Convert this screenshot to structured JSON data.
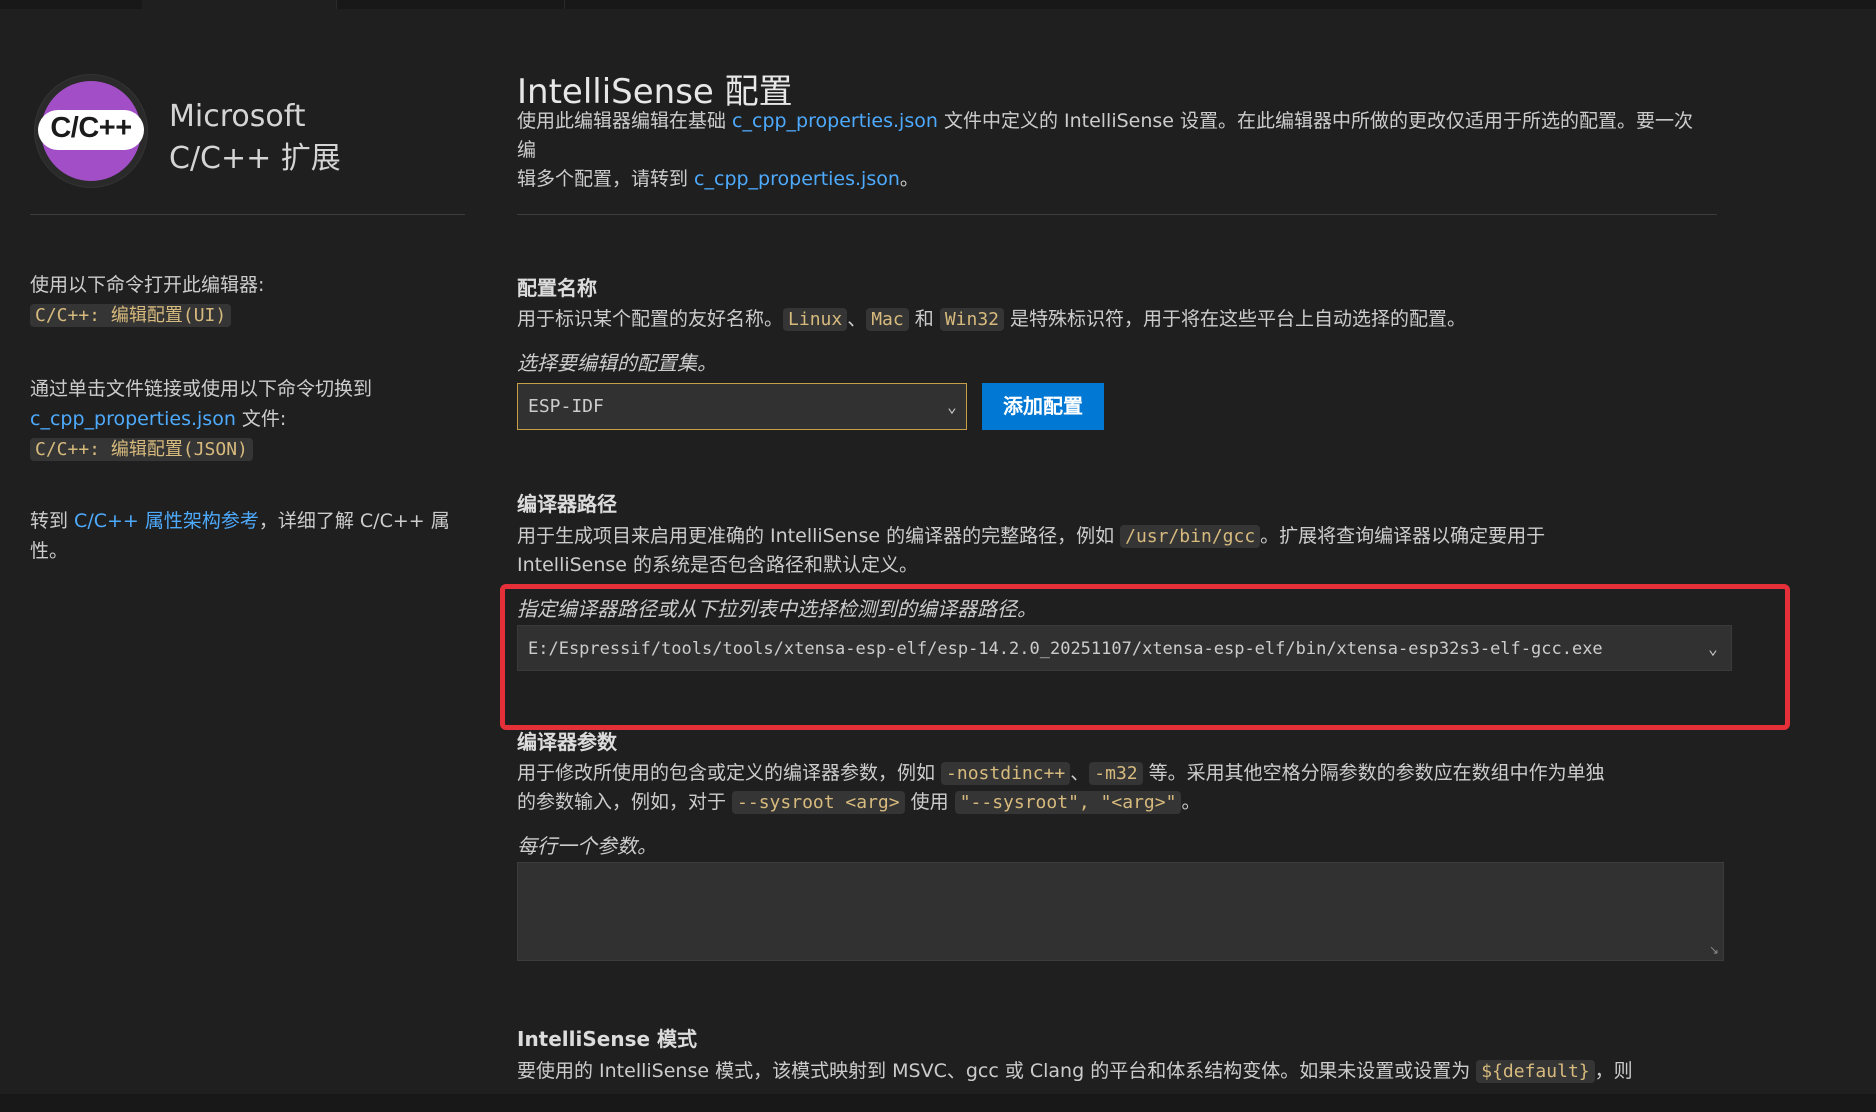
{
  "left": {
    "logo_text": "C/C++",
    "brand_line1": "Microsoft",
    "brand_line2": "C/C++ 扩展",
    "open_cmd_label": "使用以下命令打开此编辑器:",
    "open_cmd_code": "C/C++: 编辑配置(UI)",
    "switch_label_line1": "通过单击文件链接或使用以下命令切换到",
    "switch_link": "c_cpp_properties.json",
    "switch_label_tail": " 文件:",
    "switch_cmd_code": "C/C++: 编辑配置(JSON)",
    "schema_prefix": "转到 ",
    "schema_link": "C/C++ 属性架构参考",
    "schema_suffix_line1": "，详细了解 C/C++ 属",
    "schema_suffix_line2": "性。"
  },
  "header": {
    "title": "IntelliSense 配置",
    "desc_part1": "使用此编辑器编辑在基础 ",
    "desc_link1": "c_cpp_properties.json",
    "desc_part2": " 文件中定义的 IntelliSense 设置。在此编辑器中所做的更改仅适用于所选的配置。要一次编",
    "desc_part3": "辑多个配置，请转到 ",
    "desc_link2": "c_cpp_properties.json",
    "desc_part4": "。"
  },
  "config_name": {
    "title": "配置名称",
    "desc_a": "用于标识某个配置的友好名称。",
    "code1": "Linux",
    "sep1": "、",
    "code2": "Mac",
    "sep2": " 和 ",
    "code3": "Win32",
    "desc_b": " 是特殊标识符，用于将在这些平台上自动选择的配置。",
    "hint": "选择要编辑的配置集。",
    "selected": "ESP-IDF",
    "add_button": "添加配置"
  },
  "compiler_path": {
    "title": "编译器路径",
    "desc_a": "用于生成项目来启用更准确的 IntelliSense 的编译器的完整路径，例如 ",
    "code1": "/usr/bin/gcc",
    "desc_b": "。扩展将查询编译器以确定要用于",
    "desc_c": "IntelliSense 的系统是否包含路径和默认定义。",
    "hint": "指定编译器路径或从下拉列表中选择检测到的编译器路径。",
    "value": "E:/Espressif/tools/tools/xtensa-esp-elf/esp-14.2.0_20251107/xtensa-esp-elf/bin/xtensa-esp32s3-elf-gcc.exe"
  },
  "compiler_args": {
    "title": "编译器参数",
    "desc_a": "用于修改所使用的包含或定义的编译器参数，例如 ",
    "code1": "-nostdinc++",
    "sep1": "、",
    "code2": "-m32",
    "desc_b": " 等。采用其他空格分隔参数的参数应在数组中作为单独",
    "desc_c": "的参数输入，例如，对于 ",
    "code3": "--sysroot <arg>",
    "desc_d": " 使用 ",
    "code4": "\"--sysroot\", \"<arg>\"",
    "desc_e": "。",
    "hint": "每行一个参数。"
  },
  "intellisense_mode": {
    "title": "IntelliSense 模式",
    "desc_a": "要使用的 IntelliSense 模式，该模式映射到 MSVC、gcc 或 Clang 的平台和体系结构变体。如果未设置或设置为 ",
    "code1": "${default}",
    "desc_b": "，则"
  },
  "colors": {
    "background": "#1f1f1f",
    "accent_button": "#0078d4",
    "link": "#4daafc",
    "code_text": "#d7ba7d",
    "highlight_box": "#e5303a"
  }
}
